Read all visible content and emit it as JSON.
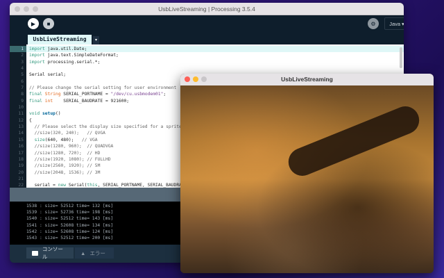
{
  "window": {
    "title": "UsbLiveStreaming | Processing 3.5.4"
  },
  "toolbar": {
    "run": "▶",
    "stop": "■",
    "debug": "⚙",
    "mode": "Java",
    "mode_caret": "▾"
  },
  "tab": {
    "name": "UsbLiveStreaming",
    "menu": "▾"
  },
  "editor": {
    "current_line": 1,
    "lines": [
      [
        [
          "import",
          "kw"
        ],
        [
          " java.util.Date;",
          ""
        ]
      ],
      [
        [
          "import",
          "kw"
        ],
        [
          " java.text.SimpleDateFormat;",
          ""
        ]
      ],
      [
        [
          "import",
          "kw"
        ],
        [
          " processing.serial.*;",
          ""
        ]
      ],
      [],
      [
        [
          "Serial serial;",
          ""
        ]
      ],
      [],
      [
        [
          "// Please change the serial setting for user environment",
          "cm"
        ]
      ],
      [
        [
          "final",
          "kw"
        ],
        [
          " ",
          ""
        ],
        [
          "String",
          "ty"
        ],
        [
          " SERIAL_PORTNAME = ",
          ""
        ],
        [
          "\"/dev/cu.usbmodem01\"",
          "st"
        ],
        [
          ";",
          ""
        ]
      ],
      [
        [
          "final",
          "kw"
        ],
        [
          " ",
          ""
        ],
        [
          "int",
          "ty"
        ],
        [
          "    SERIAL_BAUDRATE = 921600;",
          ""
        ]
      ],
      [],
      [
        [
          "void",
          "kw"
        ],
        [
          " ",
          ""
        ],
        [
          "setup",
          "fn"
        ],
        [
          "()",
          ""
        ]
      ],
      [
        [
          "{",
          ""
        ]
      ],
      [
        [
          "  // Please select the display size specified for a sprite",
          "cm"
        ]
      ],
      [
        [
          "  //size(320, 240);   // QVGA",
          "cm"
        ]
      ],
      [
        [
          "  ",
          ""
        ],
        [
          "size",
          "kw"
        ],
        [
          "(640, 480);   ",
          ""
        ],
        [
          "// VGA",
          "cm"
        ]
      ],
      [
        [
          "  //size(1280, 960);  // QUADVGA",
          "cm"
        ]
      ],
      [
        [
          "  //size(1280, 720);  // HD",
          "cm"
        ]
      ],
      [
        [
          "  //size(1920, 1080); // FULLHD",
          "cm"
        ]
      ],
      [
        [
          "  //size(2560, 1920); // 5M",
          "cm"
        ]
      ],
      [
        [
          "  //size(2048, 1536); // 3M",
          "cm"
        ]
      ],
      [],
      [
        [
          "  serial = ",
          ""
        ],
        [
          "new",
          "nw"
        ],
        [
          " Serial(",
          ""
        ],
        [
          "this",
          "nw"
        ],
        [
          ", SERIAL_PORTNAME, SERIAL_BAUDRATE);",
          ""
        ]
      ]
    ]
  },
  "console": {
    "lines": [
      "1538 : size= 52512 time= 132 [ms]",
      "1539 : size= 52736 time= 198 [ms]",
      "1540 : size= 52512 time= 143 [ms]",
      "1541 : size= 52608 time= 134 [ms]",
      "1542 : size= 52608 time= 124 [ms]",
      "1543 : size= 52512 time= 200 [ms]"
    ]
  },
  "footer": {
    "console_tab": "コンソール",
    "error_tab": "エラー"
  },
  "preview": {
    "title": "UsbLiveStreaming"
  },
  "colors": {
    "close": "#fe5f57",
    "minimize": "#febc2e",
    "zoom": "#c9c6c9"
  }
}
